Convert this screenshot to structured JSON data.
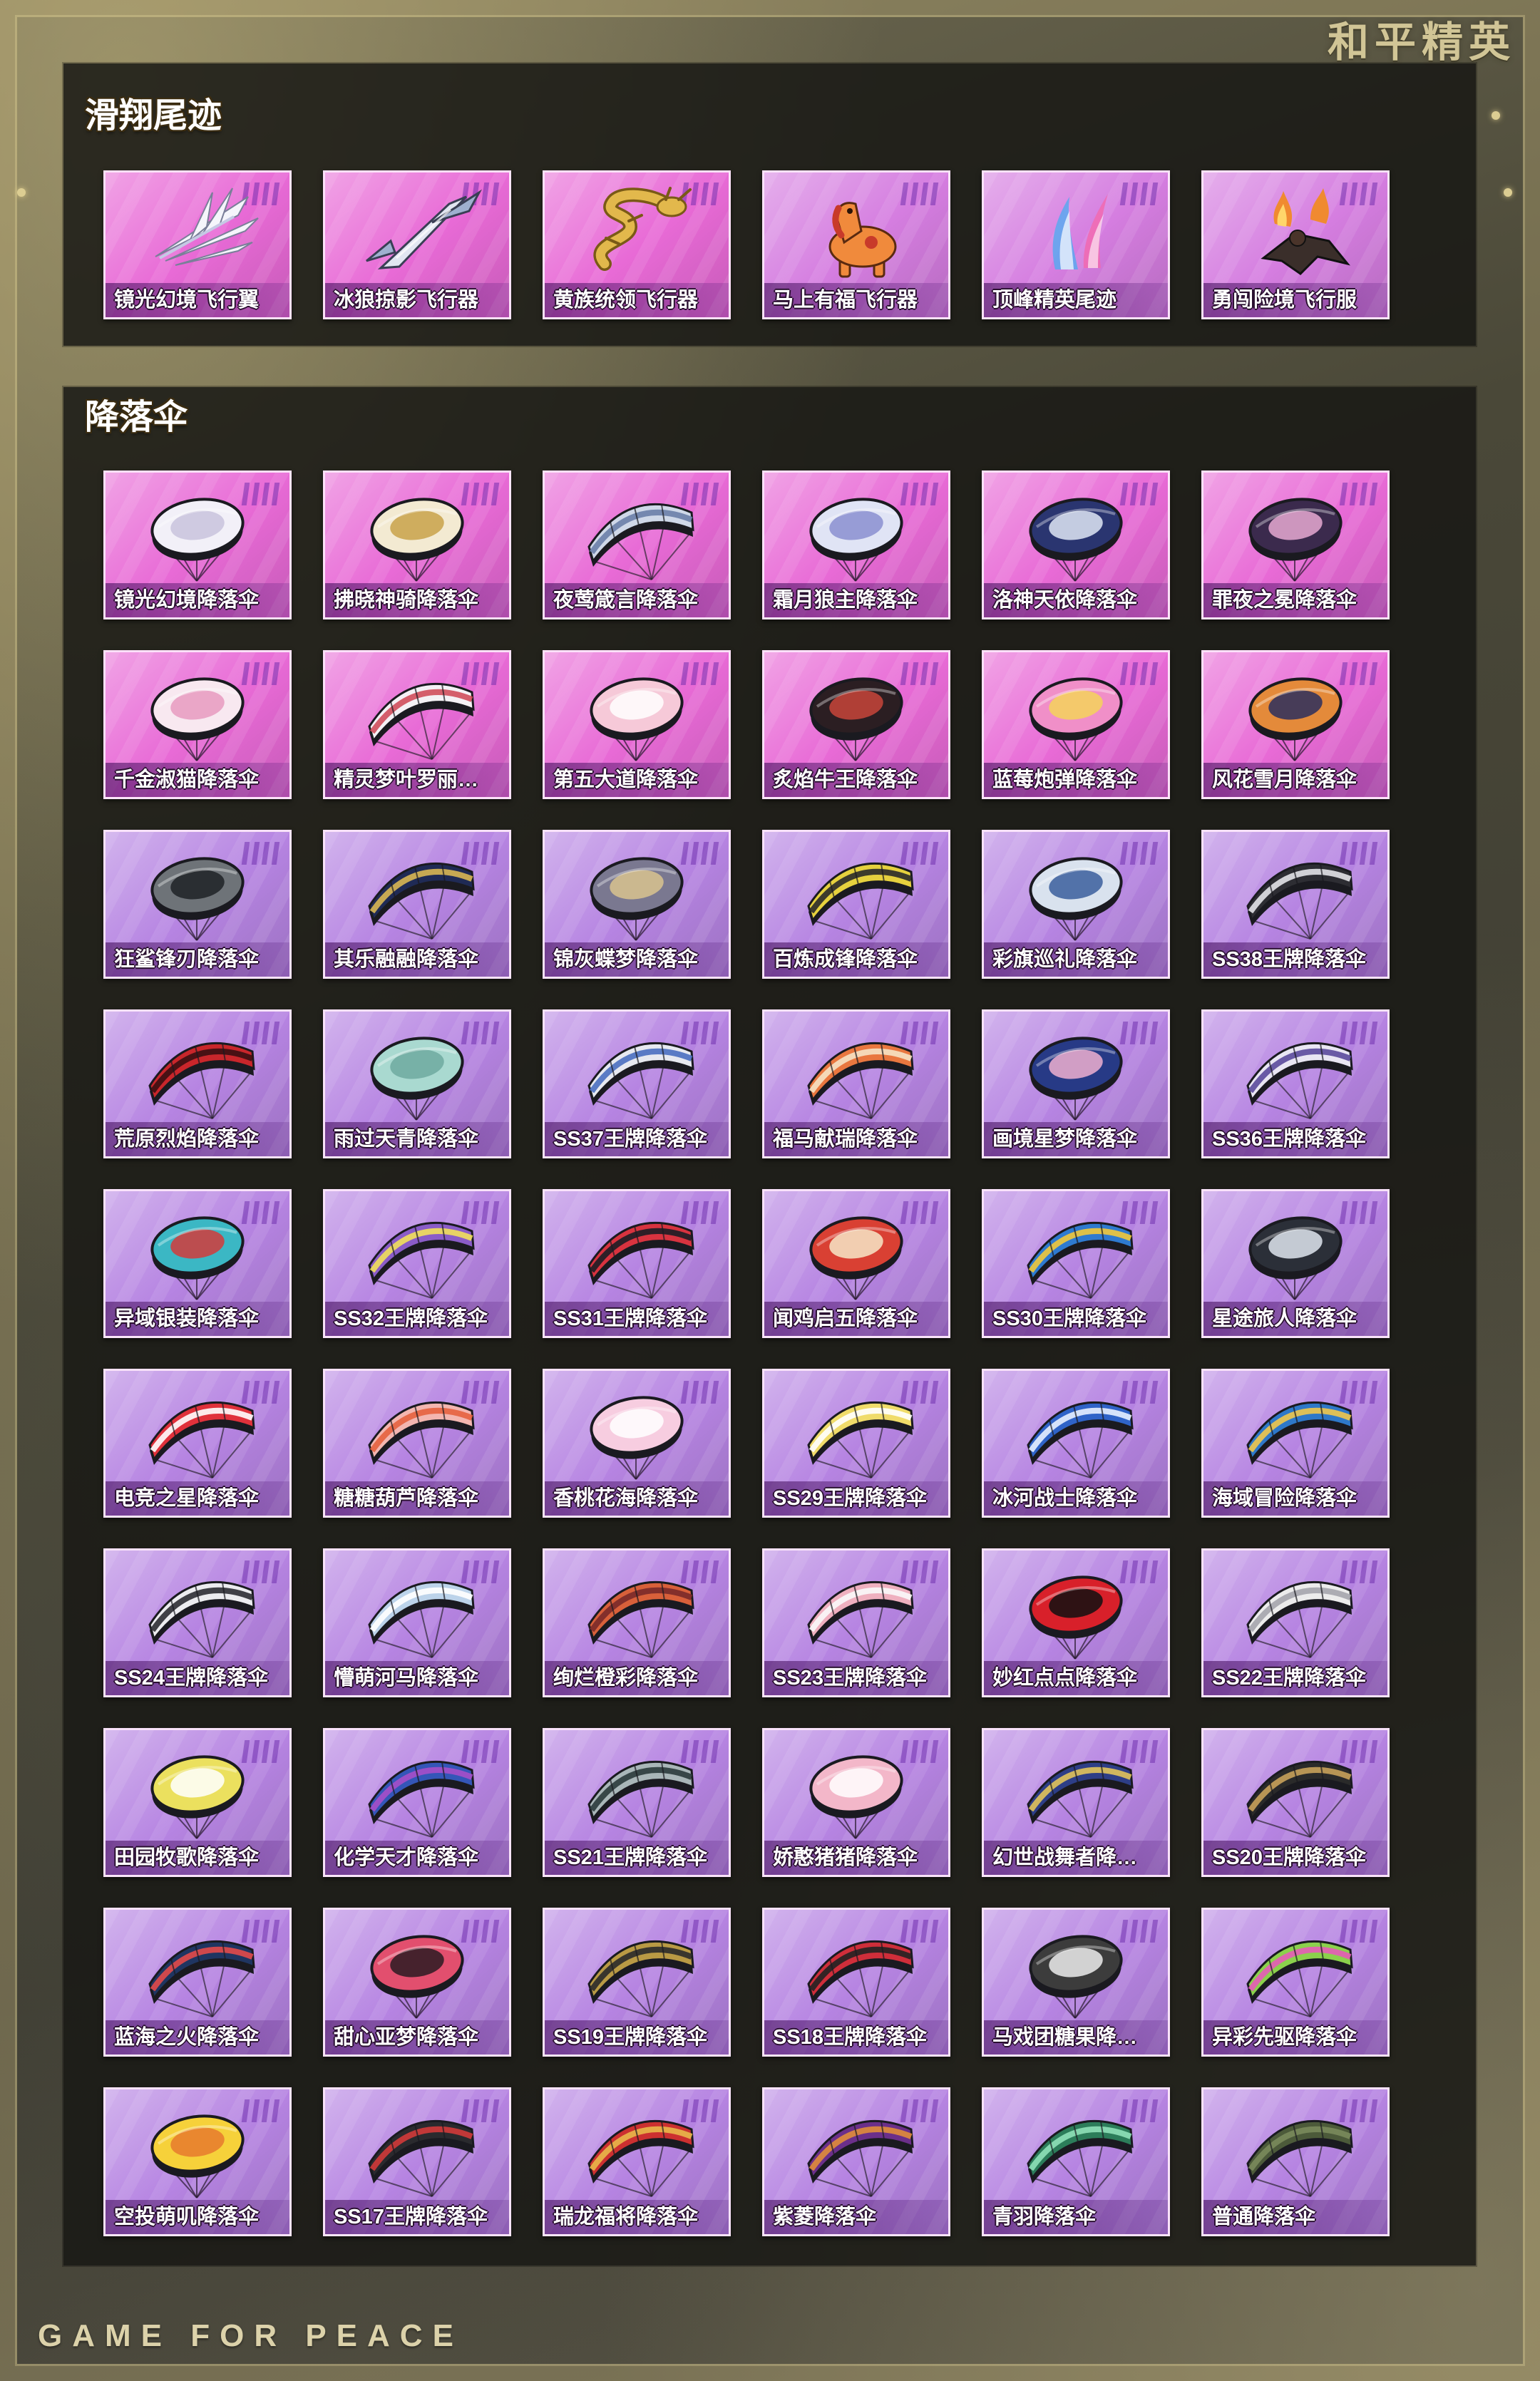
{
  "header": {
    "brand_title": "和平精英"
  },
  "footer": {
    "slogan": "GAME FOR PEACE"
  },
  "sections": [
    {
      "title": "滑翔尾迹",
      "items": [
        {
          "name": "镜光幻境飞行翼",
          "icon": "wing-icon",
          "card_color": "#e86ad6",
          "colors": [
            "#f5f5fb",
            "#c5c9e4"
          ]
        },
        {
          "name": "冰狼掠影飞行器",
          "icon": "glider-icon",
          "card_color": "#e86ad6",
          "colors": [
            "#e1e6f1",
            "#9fb0cf"
          ]
        },
        {
          "name": "黄族统领飞行器",
          "icon": "dragon-icon",
          "card_color": "#e86ad6",
          "colors": [
            "#e2b84c",
            "#7a5a16"
          ]
        },
        {
          "name": "马上有福飞行器",
          "icon": "horse-icon",
          "card_color": "#d57de0",
          "colors": [
            "#f08a3c",
            "#c83a2a"
          ]
        },
        {
          "name": "顶峰精英尾迹",
          "icon": "trail-icon",
          "card_color": "#d57de0",
          "colors": [
            "#f06ab2",
            "#5aa8f0"
          ]
        },
        {
          "name": "勇闯险境飞行服",
          "icon": "wingsuit-icon",
          "card_color": "#d57de0",
          "colors": [
            "#3a2e2a",
            "#f08a30"
          ]
        }
      ]
    },
    {
      "title": "降落伞",
      "items": [
        {
          "name": "镜光幻境降落伞",
          "icon": "round-parachute-icon",
          "card_color": "#e86ad6",
          "colors": [
            "#f2f0f8",
            "#c9c3dd"
          ]
        },
        {
          "name": "拂晓神骑降落伞",
          "icon": "round-parachute-icon",
          "card_color": "#e86ad6",
          "colors": [
            "#f3ead2",
            "#c8a24a"
          ]
        },
        {
          "name": "夜莺箴言降落伞",
          "icon": "wing-parachute-icon",
          "card_color": "#e86ad6",
          "colors": [
            "#cfd8e8",
            "#6a7fa8"
          ]
        },
        {
          "name": "霜月狼主降落伞",
          "icon": "round-parachute-icon",
          "card_color": "#e86ad6",
          "colors": [
            "#e0e4f5",
            "#8a8fd0"
          ]
        },
        {
          "name": "洛神天依降落伞",
          "icon": "round-parachute-icon",
          "card_color": "#e86ad6",
          "colors": [
            "#2a3570",
            "#dfe6f5"
          ]
        },
        {
          "name": "罪夜之冕降落伞",
          "icon": "round-parachute-icon",
          "card_color": "#e86ad6",
          "colors": [
            "#3b2a4d",
            "#e7a9d2"
          ]
        },
        {
          "name": "千金淑猫降落伞",
          "icon": "round-parachute-icon",
          "card_color": "#e86ad6",
          "colors": [
            "#f8e8f0",
            "#e79ac0"
          ]
        },
        {
          "name": "精灵梦叶罗丽…",
          "icon": "wing-parachute-icon",
          "card_color": "#e86ad6",
          "colors": [
            "#f4f1f5",
            "#d04e5c"
          ]
        },
        {
          "name": "第五大道降落伞",
          "icon": "round-parachute-icon",
          "card_color": "#e86ad6",
          "colors": [
            "#f6c9d8",
            "#ffffff"
          ]
        },
        {
          "name": "炙焰牛王降落伞",
          "icon": "round-parachute-icon",
          "card_color": "#e86ad6",
          "colors": [
            "#2b1e22",
            "#c8453a"
          ]
        },
        {
          "name": "蓝莓炮弹降落伞",
          "icon": "round-parachute-icon",
          "card_color": "#e86ad6",
          "colors": [
            "#f08fc8",
            "#f5d35a"
          ]
        },
        {
          "name": "风花雪月降落伞",
          "icon": "round-parachute-icon",
          "card_color": "#e86ad6",
          "colors": [
            "#e48a3a",
            "#2c2e5e"
          ]
        },
        {
          "name": "狂鲨锋刃降落伞",
          "icon": "round-parachute-icon",
          "card_color": "#b684e2",
          "colors": [
            "#6e7378",
            "#1e2226"
          ]
        },
        {
          "name": "其乐融融降落伞",
          "icon": "wing-parachute-icon",
          "card_color": "#b684e2",
          "colors": [
            "#1f2a55",
            "#d8b653"
          ]
        },
        {
          "name": "锦灰蝶梦降落伞",
          "icon": "round-parachute-icon",
          "card_color": "#b684e2",
          "colors": [
            "#7a7890",
            "#d9c38f"
          ]
        },
        {
          "name": "百炼成锋降落伞",
          "icon": "wing-parachute-icon",
          "card_color": "#b684e2",
          "colors": [
            "#e6d13e",
            "#2a2a2a"
          ]
        },
        {
          "name": "彩旗巡礼降落伞",
          "icon": "round-parachute-icon",
          "card_color": "#b684e2",
          "colors": [
            "#d9e2ee",
            "#3a5e9c"
          ]
        },
        {
          "name": "SS38王牌降落伞",
          "icon": "wing-parachute-icon",
          "card_color": "#b684e2",
          "colors": [
            "#2d2d33",
            "#e3e3e8"
          ]
        },
        {
          "name": "荒原烈焰降落伞",
          "icon": "wing-parachute-icon",
          "card_color": "#b684e2",
          "colors": [
            "#c9262b",
            "#3b0f12"
          ]
        },
        {
          "name": "雨过天青降落伞",
          "icon": "round-parachute-icon",
          "card_color": "#b684e2",
          "colors": [
            "#a9d9d0",
            "#6fa9a0"
          ]
        },
        {
          "name": "SS37王牌降落伞",
          "icon": "wing-parachute-icon",
          "card_color": "#b684e2",
          "colors": [
            "#e7e9f0",
            "#4a6fc0"
          ]
        },
        {
          "name": "福马献瑞降落伞",
          "icon": "wing-parachute-icon",
          "card_color": "#b684e2",
          "colors": [
            "#e9773f",
            "#f6e2c4"
          ]
        },
        {
          "name": "画境星梦降落伞",
          "icon": "round-parachute-icon",
          "card_color": "#b684e2",
          "colors": [
            "#273a86",
            "#f0b0d0"
          ]
        },
        {
          "name": "SS36王牌降落伞",
          "icon": "wing-parachute-icon",
          "card_color": "#b684e2",
          "colors": [
            "#e9e6f3",
            "#5b4a9c"
          ]
        },
        {
          "name": "异域银装降落伞",
          "icon": "round-parachute-icon",
          "card_color": "#b684e2",
          "colors": [
            "#3bb7c4",
            "#d33b3b"
          ]
        },
        {
          "name": "SS32王牌降落伞",
          "icon": "wing-parachute-icon",
          "card_color": "#b684e2",
          "colors": [
            "#8a5cc8",
            "#f1e05a"
          ]
        },
        {
          "name": "SS31王牌降落伞",
          "icon": "wing-parachute-icon",
          "card_color": "#b684e2",
          "colors": [
            "#d8333f",
            "#1d1d25"
          ]
        },
        {
          "name": "闻鸡启五降落伞",
          "icon": "round-parachute-icon",
          "card_color": "#b684e2",
          "colors": [
            "#d94033",
            "#f6e7c8"
          ]
        },
        {
          "name": "SS30王牌降落伞",
          "icon": "wing-parachute-icon",
          "card_color": "#b684e2",
          "colors": [
            "#2e7ad0",
            "#f2c83a"
          ]
        },
        {
          "name": "星途旅人降落伞",
          "icon": "round-parachute-icon",
          "card_color": "#b684e2",
          "colors": [
            "#2b2f38",
            "#dfe5ee"
          ]
        },
        {
          "name": "电竞之星降落伞",
          "icon": "wing-parachute-icon",
          "card_color": "#b684e2",
          "colors": [
            "#e0313b",
            "#ffffff"
          ]
        },
        {
          "name": "糖糖葫芦降落伞",
          "icon": "wing-parachute-icon",
          "card_color": "#b684e2",
          "colors": [
            "#f3b6b0",
            "#e6623f"
          ]
        },
        {
          "name": "香桃花海降落伞",
          "icon": "round-parachute-icon",
          "card_color": "#b684e2",
          "colors": [
            "#f7cde0",
            "#ffffff"
          ]
        },
        {
          "name": "SS29王牌降落伞",
          "icon": "wing-parachute-icon",
          "card_color": "#b684e2",
          "colors": [
            "#f0dc6a",
            "#ffffff"
          ]
        },
        {
          "name": "冰河战士降落伞",
          "icon": "wing-parachute-icon",
          "card_color": "#b684e2",
          "colors": [
            "#2f63c8",
            "#e8f0ff"
          ]
        },
        {
          "name": "海域冒险降落伞",
          "icon": "wing-parachute-icon",
          "card_color": "#b684e2",
          "colors": [
            "#2e78c9",
            "#f1c64b"
          ]
        },
        {
          "name": "SS24王牌降落伞",
          "icon": "wing-parachute-icon",
          "card_color": "#b684e2",
          "colors": [
            "#ececef",
            "#2d2d33"
          ]
        },
        {
          "name": "懵萌河马降落伞",
          "icon": "wing-parachute-icon",
          "card_color": "#b684e2",
          "colors": [
            "#bcd3ea",
            "#ffffff"
          ]
        },
        {
          "name": "绚烂橙彩降落伞",
          "icon": "wing-parachute-icon",
          "card_color": "#b684e2",
          "colors": [
            "#d8603a",
            "#7a2a2a"
          ]
        },
        {
          "name": "SS23王牌降落伞",
          "icon": "wing-parachute-icon",
          "card_color": "#b684e2",
          "colors": [
            "#efb0bf",
            "#fafafa"
          ]
        },
        {
          "name": "妙红点点降落伞",
          "icon": "round-parachute-icon",
          "card_color": "#b684e2",
          "colors": [
            "#d8202a",
            "#111111"
          ]
        },
        {
          "name": "SS22王牌降落伞",
          "icon": "wing-parachute-icon",
          "card_color": "#b684e2",
          "colors": [
            "#ececec",
            "#a5a5ad"
          ]
        },
        {
          "name": "田园牧歌降落伞",
          "icon": "round-parachute-icon",
          "card_color": "#b684e2",
          "colors": [
            "#ebe05e",
            "#ffffff"
          ]
        },
        {
          "name": "化学天才降落伞",
          "icon": "wing-parachute-icon",
          "card_color": "#b684e2",
          "colors": [
            "#3456b8",
            "#a64fc9"
          ]
        },
        {
          "name": "SS21王牌降落伞",
          "icon": "wing-parachute-icon",
          "card_color": "#b684e2",
          "colors": [
            "#a9b6b8",
            "#2b3b3c"
          ]
        },
        {
          "name": "娇憨猪猪降落伞",
          "icon": "round-parachute-icon",
          "card_color": "#b684e2",
          "colors": [
            "#f3b7c9",
            "#ffffff"
          ]
        },
        {
          "name": "幻世战舞者降…",
          "icon": "wing-parachute-icon",
          "card_color": "#b684e2",
          "colors": [
            "#2d3e87",
            "#e1c35b"
          ]
        },
        {
          "name": "SS20王牌降落伞",
          "icon": "wing-parachute-icon",
          "card_color": "#b684e2",
          "colors": [
            "#2a2a2a",
            "#c8a15a"
          ]
        },
        {
          "name": "蓝海之火降落伞",
          "icon": "wing-parachute-icon",
          "card_color": "#b684e2",
          "colors": [
            "#1f3561",
            "#e24a4a"
          ]
        },
        {
          "name": "甜心亚梦降落伞",
          "icon": "round-parachute-icon",
          "card_color": "#b684e2",
          "colors": [
            "#e24f6e",
            "#2a1a22"
          ]
        },
        {
          "name": "SS19王牌降落伞",
          "icon": "wing-parachute-icon",
          "card_color": "#b684e2",
          "colors": [
            "#b99a44",
            "#2b2b2b"
          ]
        },
        {
          "name": "SS18王牌降落伞",
          "icon": "wing-parachute-icon",
          "card_color": "#b684e2",
          "colors": [
            "#cf2e3a",
            "#222222"
          ]
        },
        {
          "name": "马戏团糖果降…",
          "icon": "round-parachute-icon",
          "card_color": "#b684e2",
          "colors": [
            "#3c3c3c",
            "#ececec"
          ]
        },
        {
          "name": "异彩先驱降落伞",
          "icon": "wing-parachute-icon",
          "card_color": "#b684e2",
          "colors": [
            "#8bd14c",
            "#e65bb8"
          ]
        },
        {
          "name": "空投萌叽降落伞",
          "icon": "round-parachute-icon",
          "card_color": "#b684e2",
          "colors": [
            "#f6d13a",
            "#e67a2e"
          ]
        },
        {
          "name": "SS17王牌降落伞",
          "icon": "wing-parachute-icon",
          "card_color": "#b684e2",
          "colors": [
            "#2a2a2e",
            "#d23a3a"
          ]
        },
        {
          "name": "瑞龙福将降落伞",
          "icon": "wing-parachute-icon",
          "card_color": "#b684e2",
          "colors": [
            "#cc3030",
            "#e9b84a"
          ]
        },
        {
          "name": "紫菱降落伞",
          "icon": "wing-parachute-icon",
          "card_color": "#b684e2",
          "colors": [
            "#6b2f8a",
            "#e18d3a"
          ]
        },
        {
          "name": "青羽降落伞",
          "icon": "wing-parachute-icon",
          "card_color": "#b684e2",
          "colors": [
            "#2c7d5a",
            "#8fe1b8"
          ]
        },
        {
          "name": "普通降落伞",
          "icon": "wing-parachute-icon",
          "card_color": "#b684e2",
          "colors": [
            "#4c5a3a",
            "#7a8a5c"
          ]
        }
      ]
    }
  ]
}
